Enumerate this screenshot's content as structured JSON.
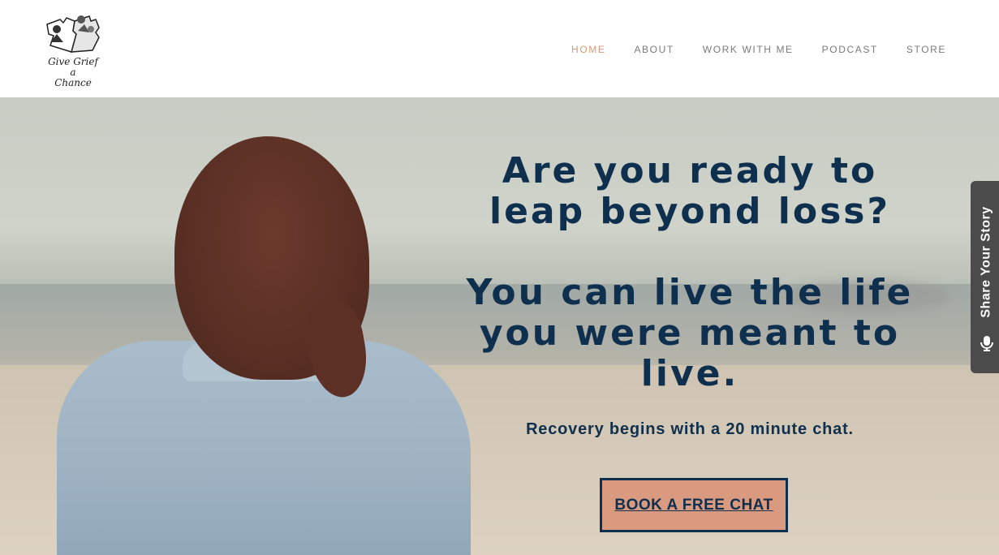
{
  "logo": {
    "text_line1": "Give Grief",
    "text_line2": "a",
    "text_line3": "Chance"
  },
  "nav": [
    {
      "label": "HOME",
      "active": true
    },
    {
      "label": "ABOUT",
      "active": false
    },
    {
      "label": "WORK WITH ME",
      "active": false
    },
    {
      "label": "PODCAST",
      "active": false
    },
    {
      "label": "STORE",
      "active": false
    }
  ],
  "hero": {
    "headline_line1": "Are you ready to",
    "headline_line2": "leap beyond loss?",
    "headline2_line1": "You can live the life",
    "headline2_line2": "you were meant to",
    "headline2_line3": "live.",
    "subheadline": "Recovery begins with a 20 minute chat.",
    "cta_label": "BOOK A FREE CHAT"
  },
  "side_tab": {
    "label": "Share Your Story",
    "icon": "microphone-icon"
  },
  "colors": {
    "navy": "#0f2f4e",
    "accent": "#d99a80",
    "nav_active": "#d39a78",
    "nav": "#7a7a7a",
    "side_tab": "#4b4b4b"
  }
}
